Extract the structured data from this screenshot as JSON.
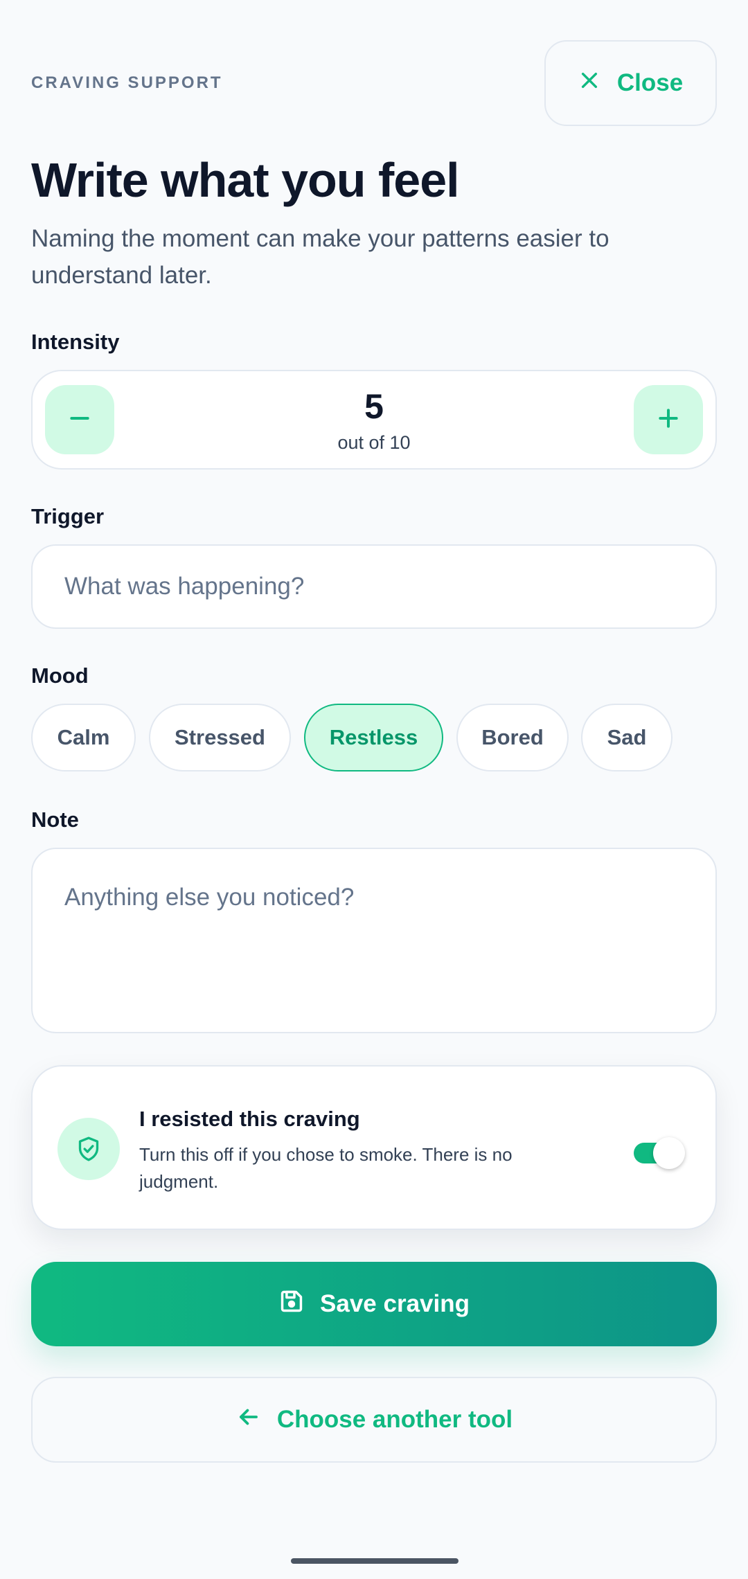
{
  "header": {
    "eyebrow": "CRAVING SUPPORT",
    "close_label": "Close",
    "close_icon": "x-icon"
  },
  "title": "Write what you feel",
  "subtitle": "Naming the moment can make your patterns easier to understand later.",
  "intensity": {
    "label": "Intensity",
    "value": "5",
    "caption": "out of 10",
    "decrement_icon": "minus-icon",
    "increment_icon": "plus-icon"
  },
  "trigger": {
    "label": "Trigger",
    "value": "",
    "placeholder": "What was happening?"
  },
  "mood": {
    "label": "Mood",
    "options": [
      "Calm",
      "Stressed",
      "Restless",
      "Bored",
      "Sad"
    ],
    "selected": "Restless"
  },
  "note": {
    "label": "Note",
    "value": "",
    "placeholder": "Anything else you noticed?"
  },
  "resisted": {
    "title": "I resisted this craving",
    "description": "Turn this off if you chose to smoke. There is no judgment.",
    "toggle_on": true,
    "icon": "shield-check-icon"
  },
  "actions": {
    "save_label": "Save craving",
    "save_icon": "save-icon",
    "back_label": "Choose another tool",
    "back_icon": "arrow-left-icon"
  },
  "colors": {
    "accent": "#10b981",
    "accent_dark": "#0d9488",
    "accent_soft": "#d1fae5",
    "background": "#f8fafc",
    "text_primary": "#0f172a",
    "text_muted": "#64748b"
  }
}
